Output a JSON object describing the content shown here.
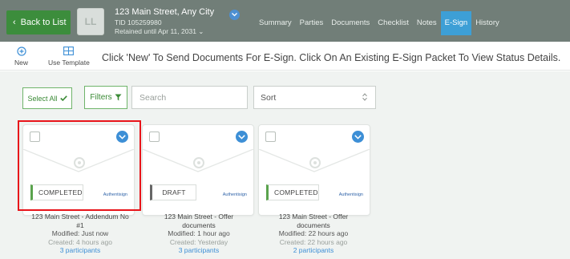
{
  "header": {
    "back_label": "Back to List",
    "thumb_text": "LL",
    "address": "123 Main Street, Any City",
    "tid": "TID 105259980",
    "retained": "Retained until Apr 11, 2031 ⌄",
    "tabs": [
      "Summary",
      "Parties",
      "Documents",
      "Checklist",
      "Notes",
      "E-Sign",
      "History"
    ],
    "active_tab": "E-Sign",
    "colors": {
      "header_bg": "#717e78",
      "back_button": "#3c8d3c",
      "active_tab": "#3d9fd6"
    }
  },
  "toolbar": {
    "new_label": "New",
    "template_label": "Use Template",
    "info_text": "Click 'New' To Send Documents For E-Sign. Click On An Existing E-Sign Packet To View Status Details."
  },
  "filters": {
    "select_all_label": "Select All",
    "filters_label": "Filters",
    "search_placeholder": "Search",
    "sort_label": "Sort"
  },
  "cards": [
    {
      "status": "COMPLETED",
      "brand": "Authentisign",
      "title_line1": "123 Main Street - Addendum No",
      "title_line2": "#1",
      "modified": "Modified: Just now",
      "created": "Created: 4 hours ago",
      "participants": "3 participants"
    },
    {
      "status": "DRAFT",
      "brand": "Authentisign",
      "title_line1": "123 Main Street - Offer",
      "title_line2": "documents",
      "modified": "Modified: 1 hour ago",
      "created": "Created: Yesterday",
      "participants": "3 participants"
    },
    {
      "status": "COMPLETED",
      "brand": "Authentisign",
      "title_line1": "123 Main Street - Offer",
      "title_line2": "documents",
      "modified": "Modified: 22 hours ago",
      "created": "Created: 22 hours ago",
      "participants": "2 participants"
    }
  ],
  "highlight_color": "#e8141a"
}
